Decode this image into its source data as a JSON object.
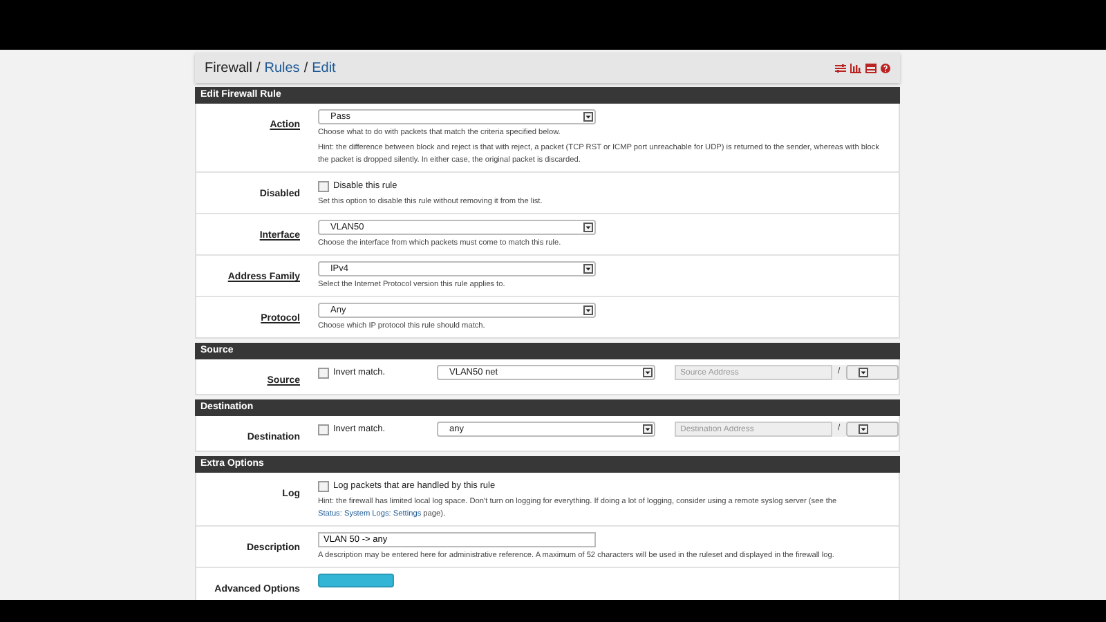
{
  "breadcrumb": [
    {
      "text": "Firewall",
      "link": false,
      "separator": "/"
    },
    {
      "text": "Rules",
      "link": true,
      "separator": "/"
    },
    {
      "text": "Edit",
      "link": true
    }
  ],
  "sections": [
    {
      "title": "Edit Firewall Rule",
      "rows": [
        {
          "kind": "select",
          "label": "Action",
          "link": true,
          "value": "Pass",
          "help": [
            {
              "text": "Choose what to do with packets that match the criteria specified below."
            },
            {
              "text": "Hint: the difference between block and reject is that with reject, a packet (TCP RST or ICMP port unreachable for UDP) is returned to the sender, whereas with block the packet is dropped silently. In either case, the original packet is discarded."
            }
          ]
        },
        {
          "kind": "checkbox",
          "label": "Disabled",
          "link": false,
          "checkbox": {
            "text": "Disable this rule",
            "checked": false
          },
          "help": [
            {
              "text": "Set this option to disable this rule without removing it from the list."
            }
          ]
        },
        {
          "kind": "select",
          "label": "Interface",
          "link": true,
          "value": "VLAN50",
          "help": [
            {
              "text": "Choose the interface from which packets must come to match this rule."
            }
          ]
        },
        {
          "kind": "select",
          "label": "Address Family",
          "link": true,
          "value": "IPv4",
          "help": [
            {
              "text": "Select the Internet Protocol version this rule applies to."
            }
          ]
        },
        {
          "kind": "select",
          "label": "Protocol",
          "link": true,
          "value": "Any",
          "help": [
            {
              "text": "Choose which IP protocol this rule should match."
            }
          ]
        }
      ]
    },
    {
      "title": "Source",
      "rows": [
        {
          "kind": "address",
          "label": "Source",
          "link": true,
          "checkbox": {
            "text": "Invert match.",
            "checked": false
          },
          "value": "VLAN50 net",
          "placeholder": "Source Address",
          "slash": "/"
        }
      ]
    },
    {
      "title": "Destination",
      "rows": [
        {
          "kind": "address",
          "label": "Destination",
          "link": false,
          "checkbox": {
            "text": "Invert match.",
            "checked": false
          },
          "value": "any",
          "placeholder": "Destination Address",
          "slash": "/"
        }
      ]
    },
    {
      "title": "Extra Options",
      "rows": [
        {
          "kind": "checkbox",
          "label": "Log",
          "link": false,
          "checkbox": {
            "text": "Log packets that are handled by this rule",
            "checked": false
          },
          "help": [
            {
              "text": "Hint: the firewall has limited local log space. Don't turn on logging for everything. If doing a lot of logging, consider using a remote syslog server (see the ",
              "link": "Status: System Logs: Settings",
              "after": " page)."
            }
          ]
        },
        {
          "kind": "text",
          "label": "Description",
          "link": false,
          "value": "VLAN 50 -> any",
          "help": [
            {
              "text": "A description may be entered here for administrative reference. A maximum of 52 characters will be used in the ruleset and displayed in the firewall log."
            }
          ]
        },
        {
          "kind": "button",
          "label": "Advanced Options",
          "link": false
        }
      ]
    }
  ]
}
